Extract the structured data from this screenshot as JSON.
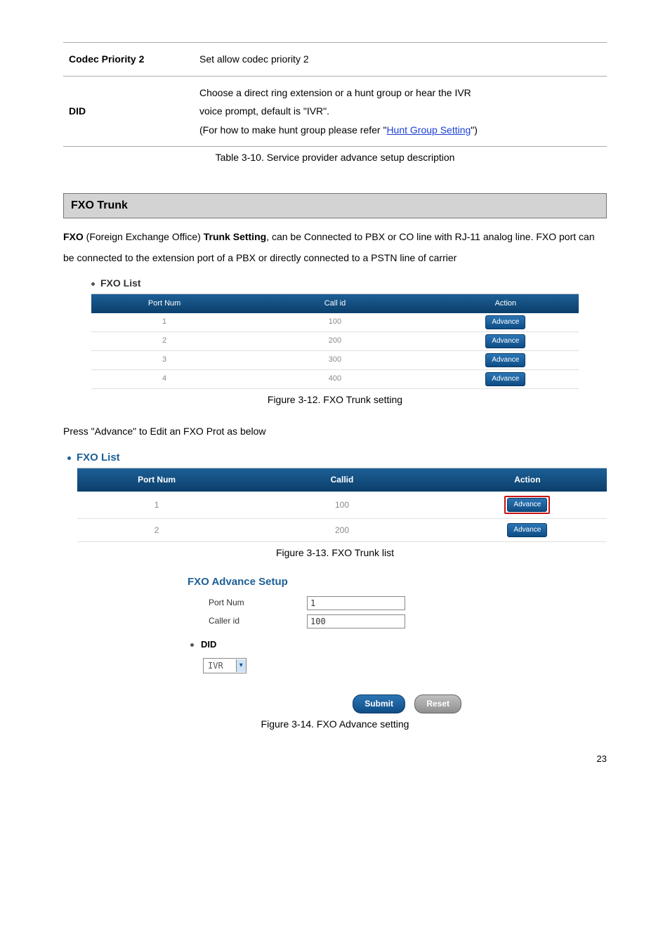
{
  "descTable": {
    "rows": [
      {
        "label": "Codec Priority 2",
        "value": "Set allow codec priority 2"
      },
      {
        "label": "DID",
        "line1": "Choose a direct ring extension or a hunt group or hear the IVR",
        "line2": "voice prompt, default is \"IVR\".",
        "line3_prefix": "(For how to make hunt group please refer \"",
        "link": "Hunt Group Setting",
        "line3_suffix": "\")"
      }
    ],
    "caption": "Table 3-10. Service provider advance setup description"
  },
  "section": {
    "heading": "FXO Trunk",
    "p1_part1": "FXO",
    "p1_part2": " (Foreign Exchange Office) ",
    "p1_part3": "Trunk Setting",
    "p1_part4": ", can be Connected to PBX or CO line with RJ-11 analog line. FXO port can be connected to the extension port of a PBX or directly connected to a PSTN line of carrier"
  },
  "fxoList1": {
    "label": "FXO List",
    "headers": [
      "Port Num",
      "Call id",
      "Action"
    ],
    "rows": [
      {
        "port": "1",
        "callid": "100",
        "action": "Advance"
      },
      {
        "port": "2",
        "callid": "200",
        "action": "Advance"
      },
      {
        "port": "3",
        "callid": "300",
        "action": "Advance"
      },
      {
        "port": "4",
        "callid": "400",
        "action": "Advance"
      }
    ],
    "caption": "Figure 3-12. FXO Trunk setting"
  },
  "pressText": "Press \"Advance\" to Edit an FXO Prot as below",
  "fxoList2": {
    "label": "FXO List",
    "headers": [
      "Port Num",
      "Callid",
      "Action"
    ],
    "rows": [
      {
        "port": "1",
        "callid": "100",
        "action": "Advance",
        "highlight": true
      },
      {
        "port": "2",
        "callid": "200",
        "action": "Advance",
        "highlight": false
      }
    ],
    "caption": "Figure 3-13. FXO Trunk list"
  },
  "advSetup": {
    "title": "FXO Advance Setup",
    "portLabel": "Port Num",
    "portValue": "1",
    "callerLabel": "Caller id",
    "callerValue": "100",
    "didLabel": "DID",
    "selectValue": "IVR",
    "submit": "Submit",
    "reset": "Reset",
    "caption": "Figure 3-14. FXO Advance setting"
  },
  "pageNumber": "23"
}
